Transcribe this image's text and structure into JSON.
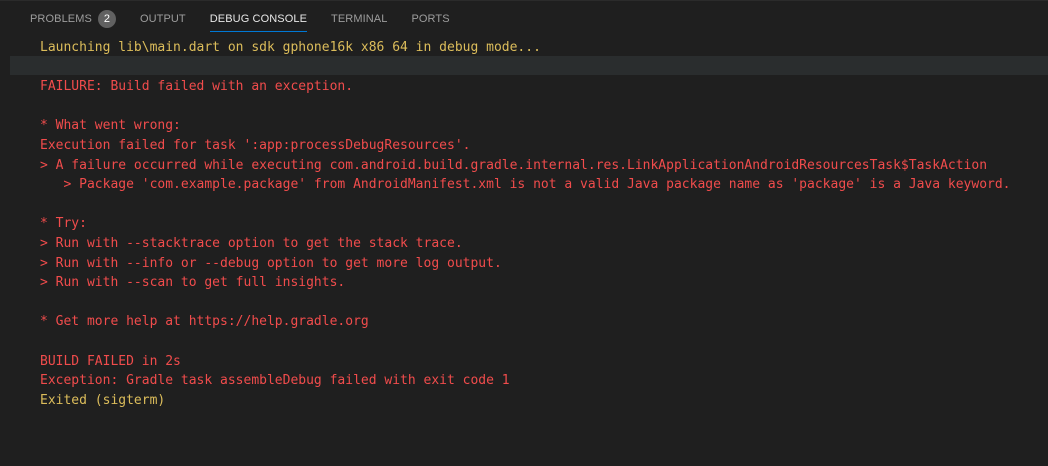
{
  "tabs": [
    {
      "label": "PROBLEMS",
      "badge": "2"
    },
    {
      "label": "OUTPUT"
    },
    {
      "label": "DEBUG CONSOLE"
    },
    {
      "label": "TERMINAL"
    },
    {
      "label": "PORTS"
    }
  ],
  "active_tab": "DEBUG CONSOLE",
  "colors": {
    "background": "#1f1f1f",
    "info_text": "#dcbd5b",
    "error_text": "#f14c4c",
    "active_tab_underline": "#0078d4"
  },
  "console": {
    "lines": [
      {
        "text": "Launching lib\\main.dart on sdk gphone16k x86 64 in debug mode...",
        "color": "yellow"
      },
      {
        "text": "",
        "color": "red"
      },
      {
        "text": "FAILURE: Build failed with an exception.",
        "color": "red"
      },
      {
        "text": "",
        "color": "red"
      },
      {
        "text": "* What went wrong:",
        "color": "red"
      },
      {
        "text": "Execution failed for task ':app:processDebugResources'.",
        "color": "red"
      },
      {
        "text": "> A failure occurred while executing com.android.build.gradle.internal.res.LinkApplicationAndroidResourcesTask$TaskAction",
        "color": "red"
      },
      {
        "text": "   > Package 'com.example.package' from AndroidManifest.xml is not a valid Java package name as 'package' is a Java keyword.",
        "color": "red"
      },
      {
        "text": "",
        "color": "red"
      },
      {
        "text": "* Try:",
        "color": "red"
      },
      {
        "text": "> Run with --stacktrace option to get the stack trace.",
        "color": "red"
      },
      {
        "text": "> Run with --info or --debug option to get more log output.",
        "color": "red"
      },
      {
        "text": "> Run with --scan to get full insights.",
        "color": "red"
      },
      {
        "text": "",
        "color": "red"
      },
      {
        "text": "* Get more help at https://help.gradle.org",
        "color": "red"
      },
      {
        "text": "",
        "color": "red"
      },
      {
        "text": "BUILD FAILED in 2s",
        "color": "red"
      },
      {
        "text": "Exception: Gradle task assembleDebug failed with exit code 1",
        "color": "red"
      },
      {
        "text": "Exited (sigterm)",
        "color": "yellow"
      }
    ]
  }
}
